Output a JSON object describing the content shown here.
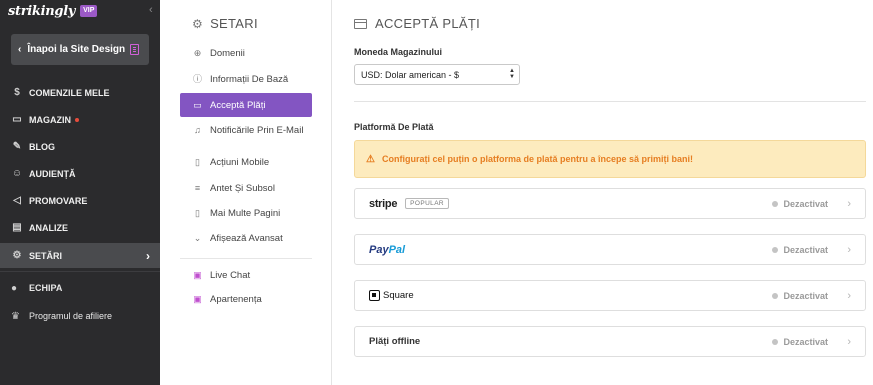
{
  "sidebar": {
    "brand": "strikingly",
    "badge": "VIP",
    "back_label": "Înapoi la Site Design",
    "items": [
      {
        "label": "COMENZILE MELE",
        "icon": "dollar-circle-icon"
      },
      {
        "label": "MAGAZIN",
        "icon": "store-icon"
      },
      {
        "label": "BLOG",
        "icon": "pen-icon"
      },
      {
        "label": "AUDIENȚĂ",
        "icon": "audience-icon"
      },
      {
        "label": "PROMOVARE",
        "icon": "megaphone-icon"
      },
      {
        "label": "ANALIZE",
        "icon": "chart-icon"
      },
      {
        "label": "SETĂRI",
        "icon": "gear-icon"
      }
    ],
    "team_label": "ECHIPA",
    "affiliate_label": "Programul de afiliere"
  },
  "settings": {
    "title": "SETARI",
    "items": [
      {
        "label": "Domenii",
        "icon": "globe-icon"
      },
      {
        "label": "Informații De Bază",
        "icon": "info-icon"
      },
      {
        "label": "Acceptă Plăți",
        "icon": "credit-card-icon"
      },
      {
        "label": "Notificările Prin E-Mail",
        "icon": "bell-icon"
      },
      {
        "label": "Acțiuni Mobile",
        "icon": "mobile-icon"
      },
      {
        "label": "Antet Și Subsol",
        "icon": "header-footer-icon"
      },
      {
        "label": "Mai Multe Pagini",
        "icon": "pages-icon"
      },
      {
        "label": "Afișează Avansat",
        "icon": "chevron-down-icon"
      }
    ],
    "extra_items": [
      {
        "label": "Live Chat",
        "icon": "chat-icon"
      },
      {
        "label": "Apartenența",
        "icon": "membership-icon"
      }
    ]
  },
  "main": {
    "title": "ACCEPTĂ PLĂȚI",
    "currency_label": "Moneda Magazinului",
    "currency_value": "USD: Dolar american - $",
    "platform_label": "Platformă De Plată",
    "warning": "Configurați cel puțin o platforma de plată pentru a începe să primiți bani!",
    "gateways": [
      {
        "name": "stripe",
        "badge": "POPULAR",
        "status": "Dezactivat"
      },
      {
        "name_pay": "Pay",
        "name_pal": "Pal",
        "status": "Dezactivat"
      },
      {
        "name": "Square",
        "status": "Dezactivat"
      },
      {
        "name": "Plăți offline",
        "status": "Dezactivat"
      }
    ]
  },
  "colors": {
    "sidebar_bg": "#2b2b2d",
    "accent": "#8355c2",
    "warning_bg": "#fdebbe",
    "warning_text": "#e67e22"
  }
}
